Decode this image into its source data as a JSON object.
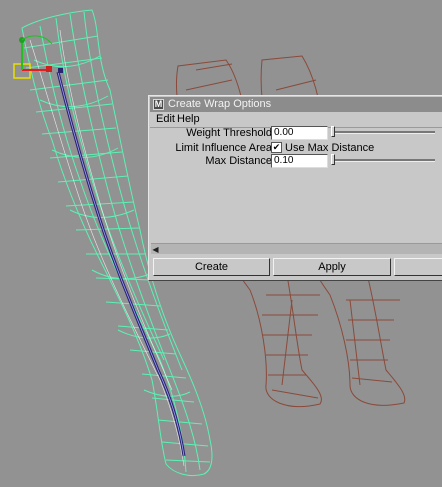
{
  "dialog": {
    "title": "Create Wrap Options",
    "app_icon": "maya-logo-icon",
    "menu": [
      "Edit",
      "Help"
    ],
    "weight_threshold": {
      "label": "Weight Threshold",
      "value": "0.00",
      "slider_fraction": 0.0
    },
    "limit_influence": {
      "label": "Limit Influence Area",
      "checkbox_label": "Use Max Distance",
      "checked": true,
      "check_glyph": "✔"
    },
    "max_distance": {
      "label": "Max Distance",
      "value": "0.10",
      "slider_fraction": 0.0
    },
    "scroll_arrow_glyph": "◀",
    "buttons": [
      "Create",
      "Apply",
      ""
    ]
  },
  "viewport": {
    "background": "#929292",
    "active_wire_color": "#5bf2b4",
    "inactive_wire_color": "#8a4a3a",
    "joint_color": "#2a2570"
  }
}
